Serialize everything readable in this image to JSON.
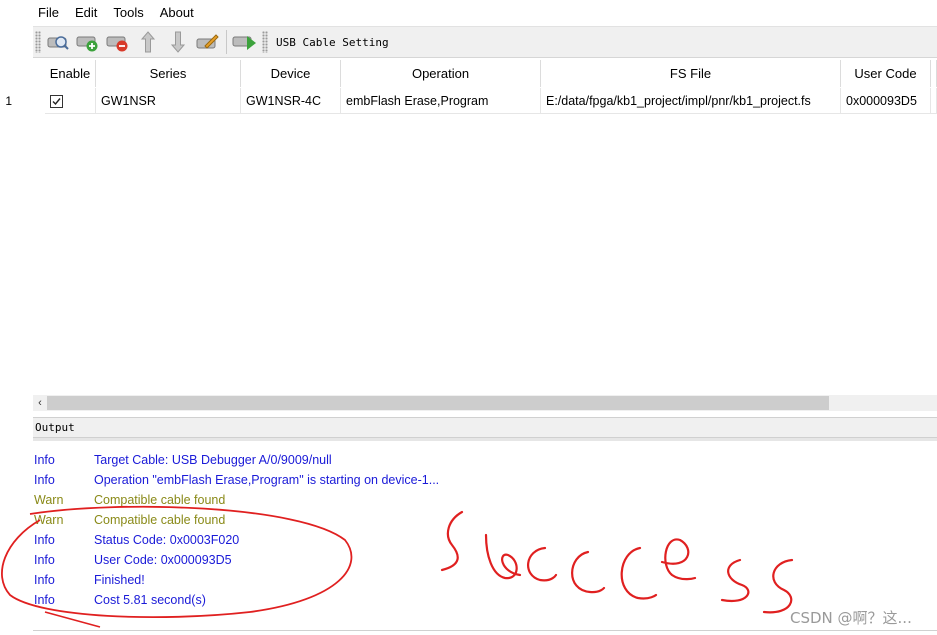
{
  "menu": [
    "File",
    "Edit",
    "Tools",
    "About"
  ],
  "toolbar": {
    "cable_label": "USB Cable Setting",
    "buttons": [
      "scan-device",
      "add-device",
      "remove-device",
      "move-up",
      "move-down",
      "edit-device",
      "program-device"
    ]
  },
  "table": {
    "columns": [
      "Enable",
      "Series",
      "Device",
      "Operation",
      "FS File",
      "User Code"
    ],
    "rows": [
      {
        "index": "1",
        "enabled": true,
        "series": "GW1NSR",
        "device": "GW1NSR-4C",
        "operation": "embFlash Erase,Program",
        "fs_file": "E:/data/fpga/kb1_project/impl/pnr/kb1_project.fs",
        "user_code": "0x000093D5"
      }
    ]
  },
  "output": {
    "title": "Output",
    "lines": [
      {
        "level": "Info",
        "message": "Target Cable: USB Debugger A/0/9009/null"
      },
      {
        "level": "Info",
        "message": "Operation \"embFlash Erase,Program\" is starting on device-1..."
      },
      {
        "level": "Warn",
        "message": "Compatible cable found"
      },
      {
        "level": "Warn",
        "message": "Compatible cable found"
      },
      {
        "level": "Info",
        "message": "Status Code: 0x0003F020"
      },
      {
        "level": "Info",
        "message": "User Code: 0x000093D5"
      },
      {
        "level": "Info",
        "message": "Finished!"
      },
      {
        "level": "Info",
        "message": "Cost 5.81 second(s)"
      }
    ]
  },
  "annotation_text": "success",
  "watermark": "CSDN @啊？这...",
  "colors": {
    "info": "#1a1ad8",
    "warn": "#8a8a18",
    "ink": "#e02020"
  }
}
